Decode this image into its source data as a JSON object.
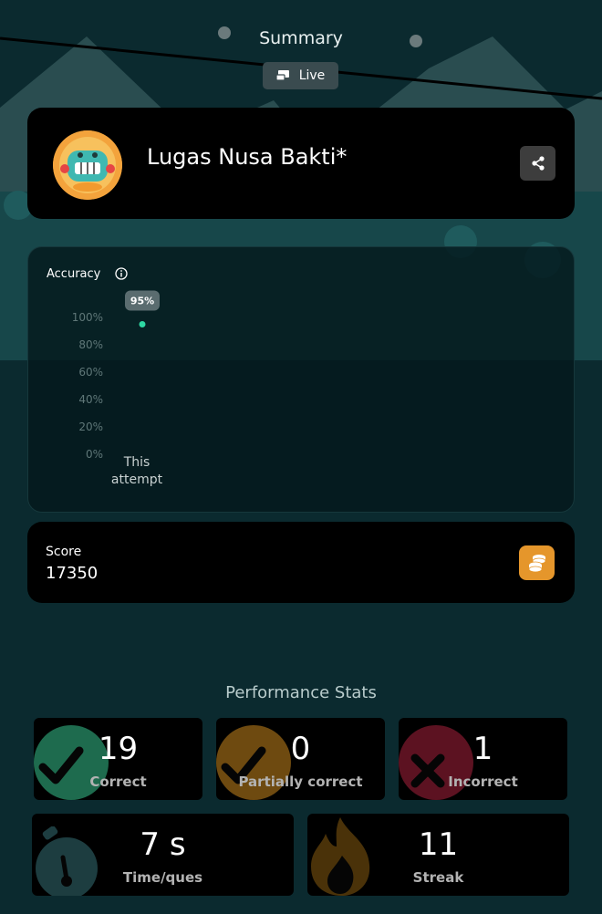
{
  "header": {
    "title": "Summary",
    "live_label": "Live"
  },
  "profile": {
    "name": "Lugas Nusa Bakti*",
    "avatar_icon": "monster-avatar-icon",
    "share_icon": "share-icon"
  },
  "accuracy": {
    "title": "Accuracy",
    "info_icon": "info-icon",
    "chart_data": {
      "type": "scatter",
      "categories": [
        "This attempt"
      ],
      "series": [
        {
          "values": [
            95
          ]
        }
      ],
      "data_labels": [
        "95%"
      ],
      "yticks": [
        "100%",
        "80%",
        "60%",
        "40%",
        "20%",
        "0%"
      ],
      "ylim": [
        0,
        100
      ],
      "point_color": "#2ed8a3"
    }
  },
  "score": {
    "label": "Score",
    "value": "17350",
    "icon": "coins-icon"
  },
  "performance": {
    "title": "Performance Stats",
    "stats": [
      {
        "value": "19",
        "label": "Correct",
        "icon": "check-icon",
        "color": "#1e6b4e"
      },
      {
        "value": "0",
        "label": "Partially correct",
        "icon": "check-icon",
        "color": "#6e4a10"
      },
      {
        "value": "1",
        "label": "Incorrect",
        "icon": "cross-icon",
        "color": "#5c1221"
      },
      {
        "value": "7 s",
        "label": "Time/ques",
        "icon": "stopwatch-icon",
        "color": "#1d3d40"
      },
      {
        "value": "11",
        "label": "Streak",
        "icon": "flame-icon",
        "color": "#4a3209"
      }
    ]
  }
}
